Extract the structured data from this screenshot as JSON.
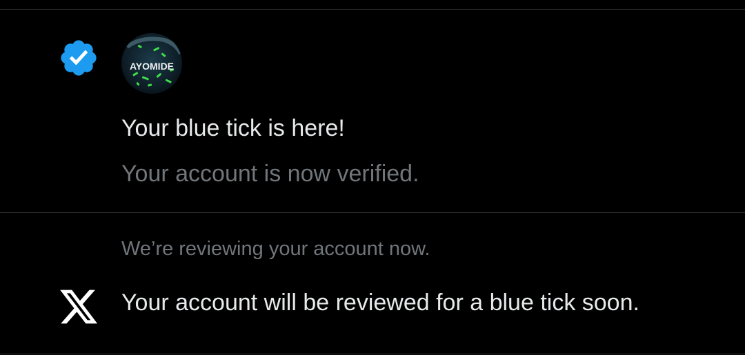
{
  "notifications": [
    {
      "icon": "verified-badge-icon",
      "icon_color": "#1d9bf0",
      "avatar_text": "AYOMIDE",
      "title": "Your blue tick is here!",
      "subtitle": "Your account is now verified."
    },
    {
      "icon": "x-logo-icon",
      "subtitle": "We’re reviewing your account now.",
      "title": "Your account will be reviewed for a blue tick soon."
    }
  ],
  "colors": {
    "background": "#000000",
    "divider": "#2f3336",
    "primary_text": "#e7e9ea",
    "secondary_text": "#71767b",
    "accent": "#1d9bf0"
  }
}
